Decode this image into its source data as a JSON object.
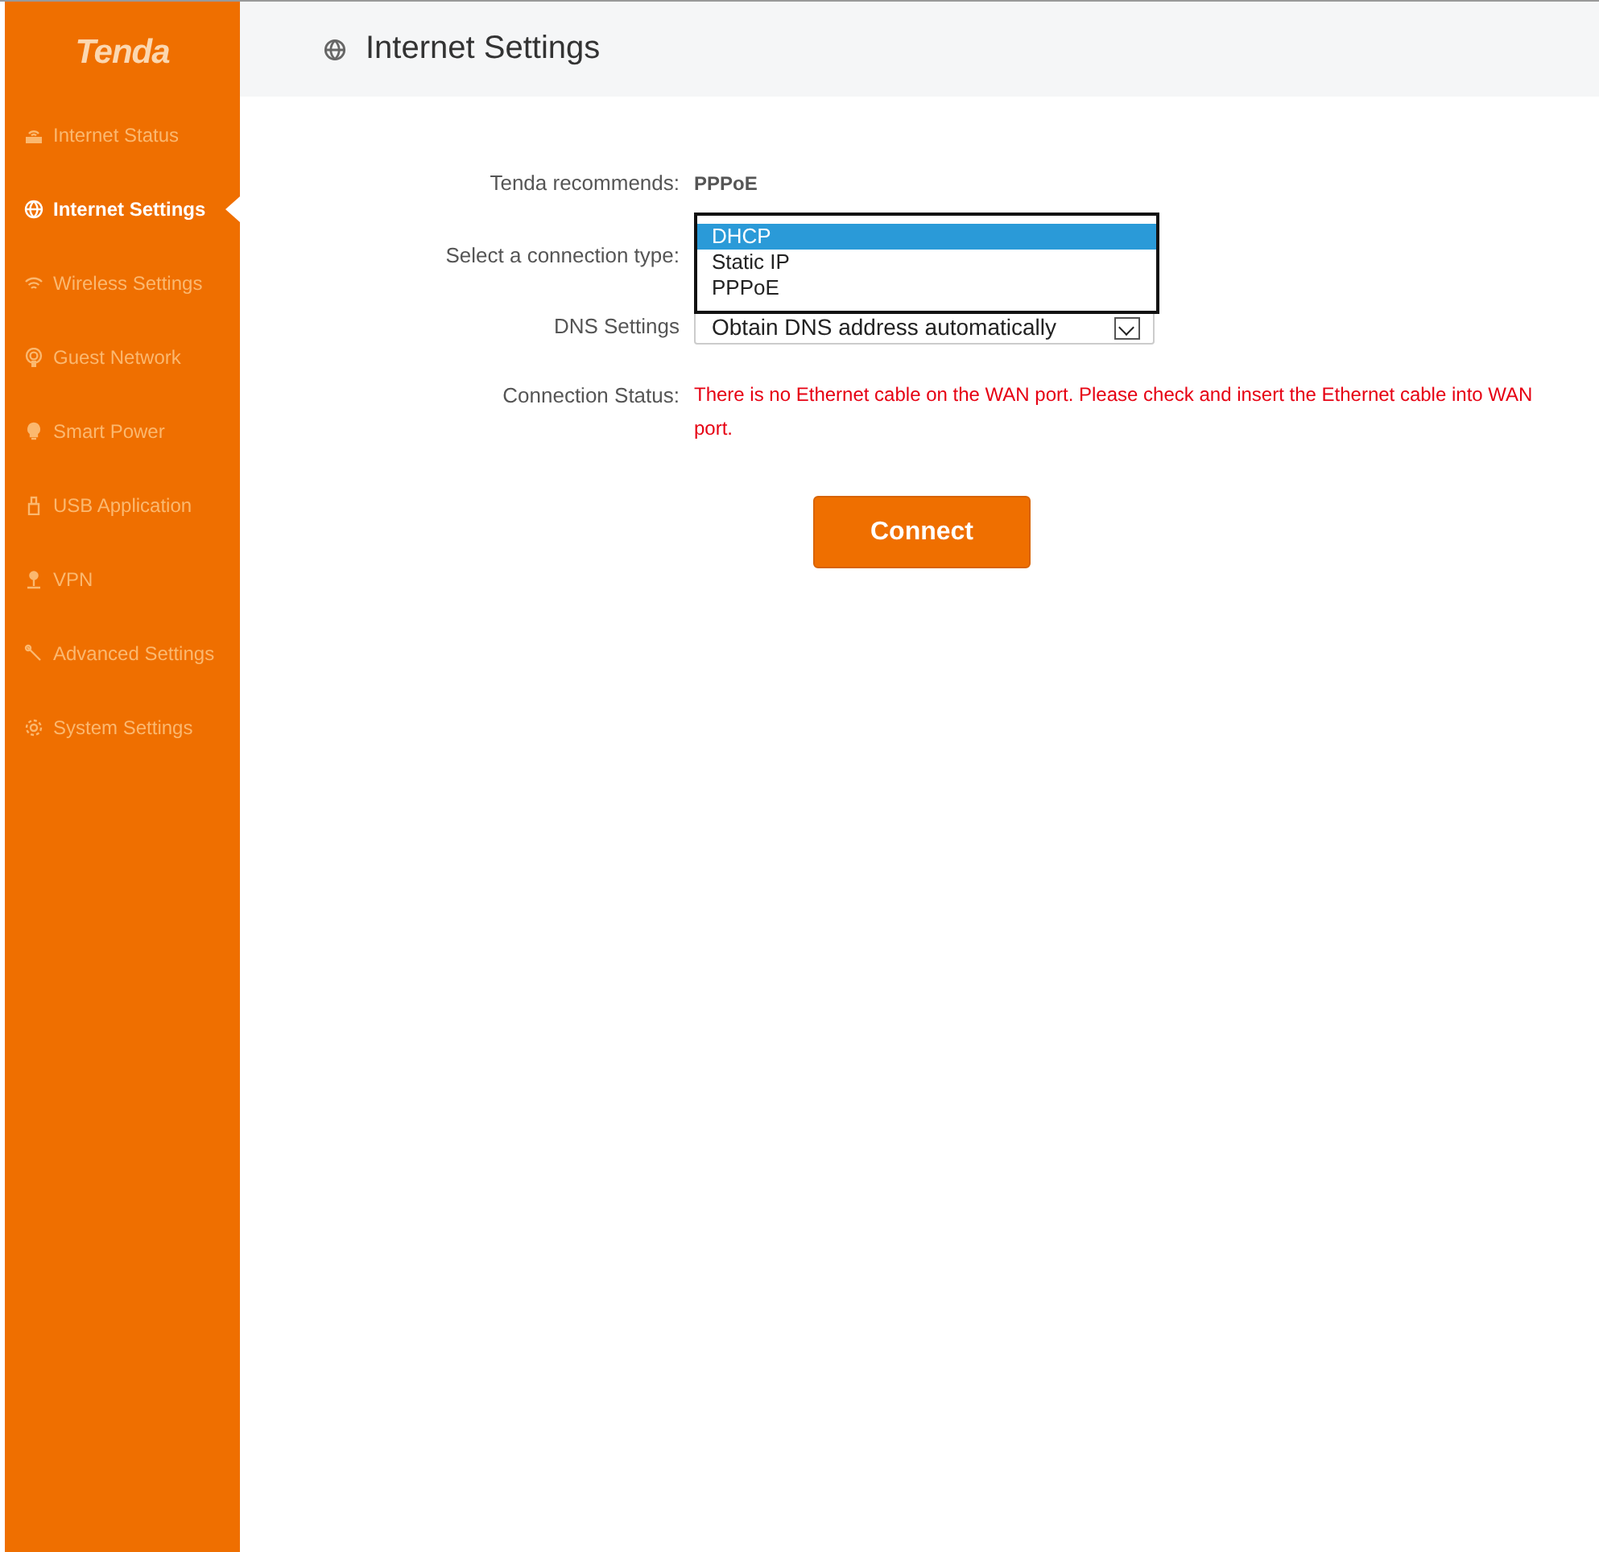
{
  "logo": "Tenda",
  "sidebar": {
    "items": [
      {
        "label": "Internet Status",
        "selected": false
      },
      {
        "label": "Internet Settings",
        "selected": true
      },
      {
        "label": "Wireless Settings",
        "selected": false
      },
      {
        "label": "Guest Network",
        "selected": false
      },
      {
        "label": "Smart Power",
        "selected": false
      },
      {
        "label": "USB Application",
        "selected": false
      },
      {
        "label": "VPN",
        "selected": false
      },
      {
        "label": "Advanced Settings",
        "selected": false
      },
      {
        "label": "System Settings",
        "selected": false
      }
    ]
  },
  "header": {
    "title": "Internet Settings"
  },
  "form": {
    "recommend": {
      "label": "Tenda recommends:",
      "value": "PPPoE"
    },
    "connection_type": {
      "label": "Select a connection type:",
      "options": [
        {
          "label": "DHCP",
          "selected": true
        },
        {
          "label": "Static IP",
          "selected": false
        },
        {
          "label": "PPPoE",
          "selected": false
        }
      ]
    },
    "dns": {
      "label": "DNS Settings",
      "value": "Obtain DNS address automatically"
    },
    "status": {
      "label": "Connection Status:",
      "message": "There is no Ethernet cable on the WAN port. Please check and insert the Ethernet cable into WAN port."
    }
  },
  "buttons": [
    "Connect"
  ]
}
